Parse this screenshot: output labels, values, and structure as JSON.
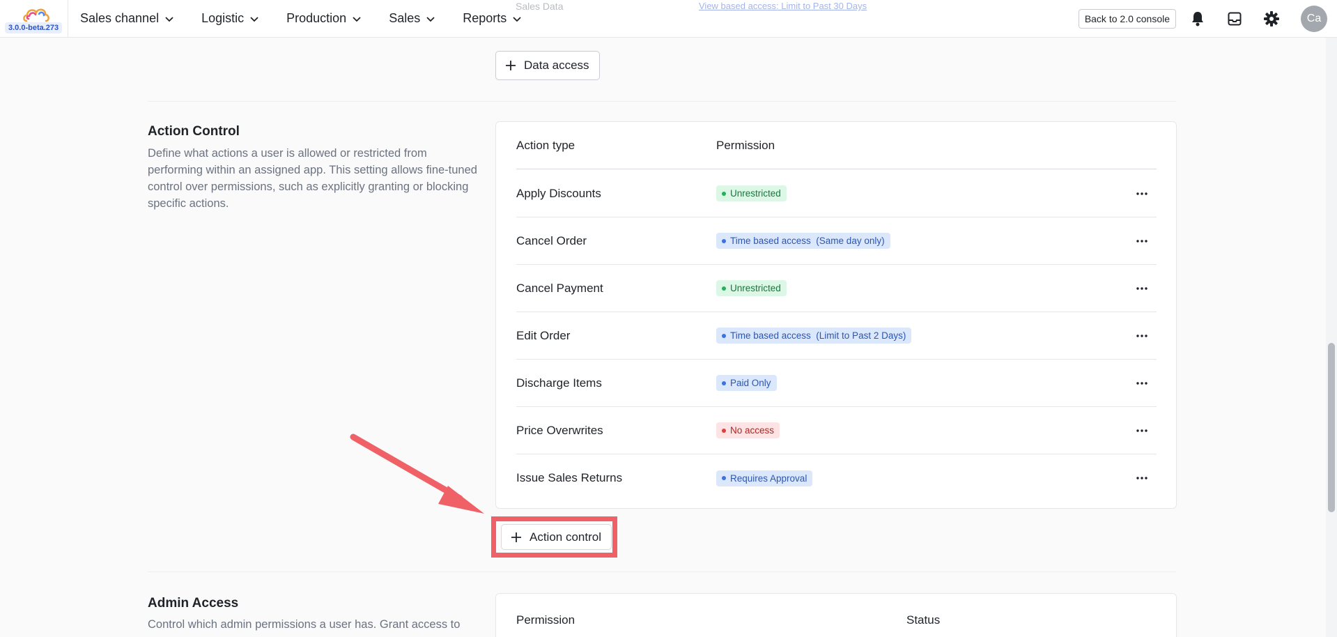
{
  "app": {
    "version": "3.0.0-beta.273",
    "colors": {
      "accent": "#f06067",
      "brand_blue": "#2c54c7"
    }
  },
  "nav": {
    "items": [
      {
        "label": "Sales channel"
      },
      {
        "label": "Logistic"
      },
      {
        "label": "Production"
      },
      {
        "label": "Sales"
      },
      {
        "label": "Reports"
      }
    ]
  },
  "topbar": {
    "back_label": "Back to 2.0 console",
    "avatar_initials": "Ca",
    "icons": [
      "bell-icon",
      "inbox-icon",
      "gear-icon"
    ]
  },
  "peek": {
    "text": "Sales Data",
    "link": "View based access: Limit to Past 30 Days"
  },
  "data_access": {
    "add_label": "Data access"
  },
  "action_control": {
    "title": "Action Control",
    "description": "Define what actions a user is allowed or restricted from performing within an assigned app. This setting allows fine-tuned control over permissions, such as explicitly granting or blocking specific actions.",
    "table": {
      "col_action": "Action type",
      "col_permission": "Permission",
      "rows": [
        {
          "action": "Apply Discounts",
          "permission": "Unrestricted",
          "status_color": "green"
        },
        {
          "action": "Cancel Order",
          "permission": "Time based access  (Same day only)",
          "status_color": "blue"
        },
        {
          "action": "Cancel Payment",
          "permission": "Unrestricted",
          "status_color": "green"
        },
        {
          "action": "Edit Order",
          "permission": "Time based access  (Limit to Past 2 Days)",
          "status_color": "blue"
        },
        {
          "action": "Discharge Items",
          "permission": "Paid Only",
          "status_color": "blue"
        },
        {
          "action": "Price Overwrites",
          "permission": "No access",
          "status_color": "red"
        },
        {
          "action": "Issue Sales Returns",
          "permission": "Requires Approval",
          "status_color": "blue"
        }
      ]
    },
    "add_label": "Action control"
  },
  "admin_access": {
    "title": "Admin Access",
    "description": "Control which admin permissions a user has. Grant access to",
    "col_permission": "Permission",
    "col_status": "Status"
  }
}
